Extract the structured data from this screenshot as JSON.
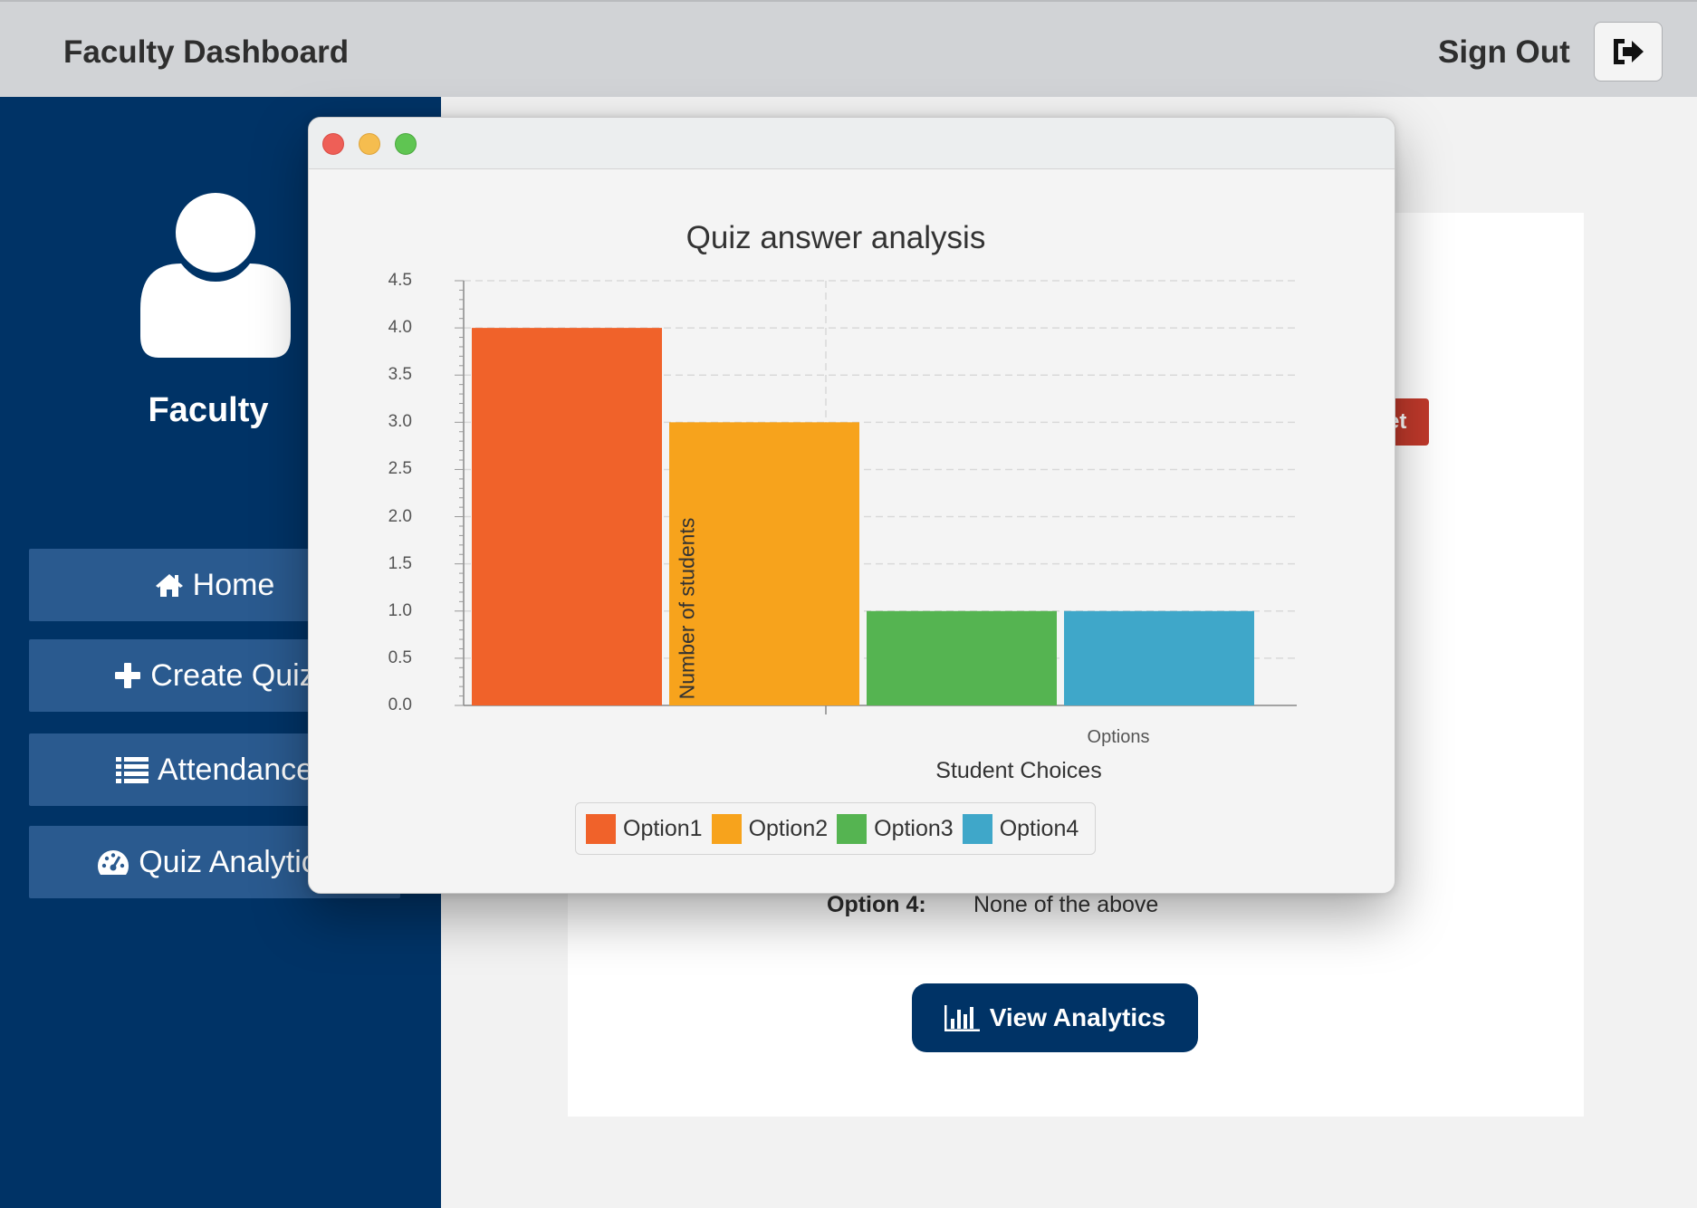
{
  "header": {
    "title": "Faculty Dashboard",
    "sign_out_label": "Sign Out"
  },
  "sidebar": {
    "role": "Faculty",
    "items": [
      {
        "label": "Home",
        "icon": "home-icon"
      },
      {
        "label": "Create Quiz",
        "icon": "plus-icon"
      },
      {
        "label": "Attendance",
        "icon": "list-icon"
      },
      {
        "label": "Quiz Analytics",
        "icon": "dashboard-gauge-icon"
      }
    ]
  },
  "content": {
    "red_button_label": "et",
    "option4_label": "Option 4:",
    "option4_value": "None of the above",
    "view_analytics_label": "View Analytics"
  },
  "chart_data": {
    "type": "bar",
    "title": "Quiz answer analysis",
    "xlabel": "Student Choices",
    "ylabel": "Number of students",
    "categories": [
      "Options"
    ],
    "series": [
      {
        "name": "Option1",
        "values": [
          4
        ],
        "color": "#f0622a"
      },
      {
        "name": "Option2",
        "values": [
          3
        ],
        "color": "#f7a31c"
      },
      {
        "name": "Option3",
        "values": [
          1
        ],
        "color": "#55b451"
      },
      {
        "name": "Option4",
        "values": [
          1
        ],
        "color": "#3fa7c9"
      }
    ],
    "ylim": [
      0,
      4.5
    ],
    "yticks": [
      "0.0",
      "0.5",
      "1.0",
      "1.5",
      "2.0",
      "2.5",
      "3.0",
      "3.5",
      "4.0",
      "4.5"
    ],
    "grid": true,
    "legend_position": "bottom"
  }
}
